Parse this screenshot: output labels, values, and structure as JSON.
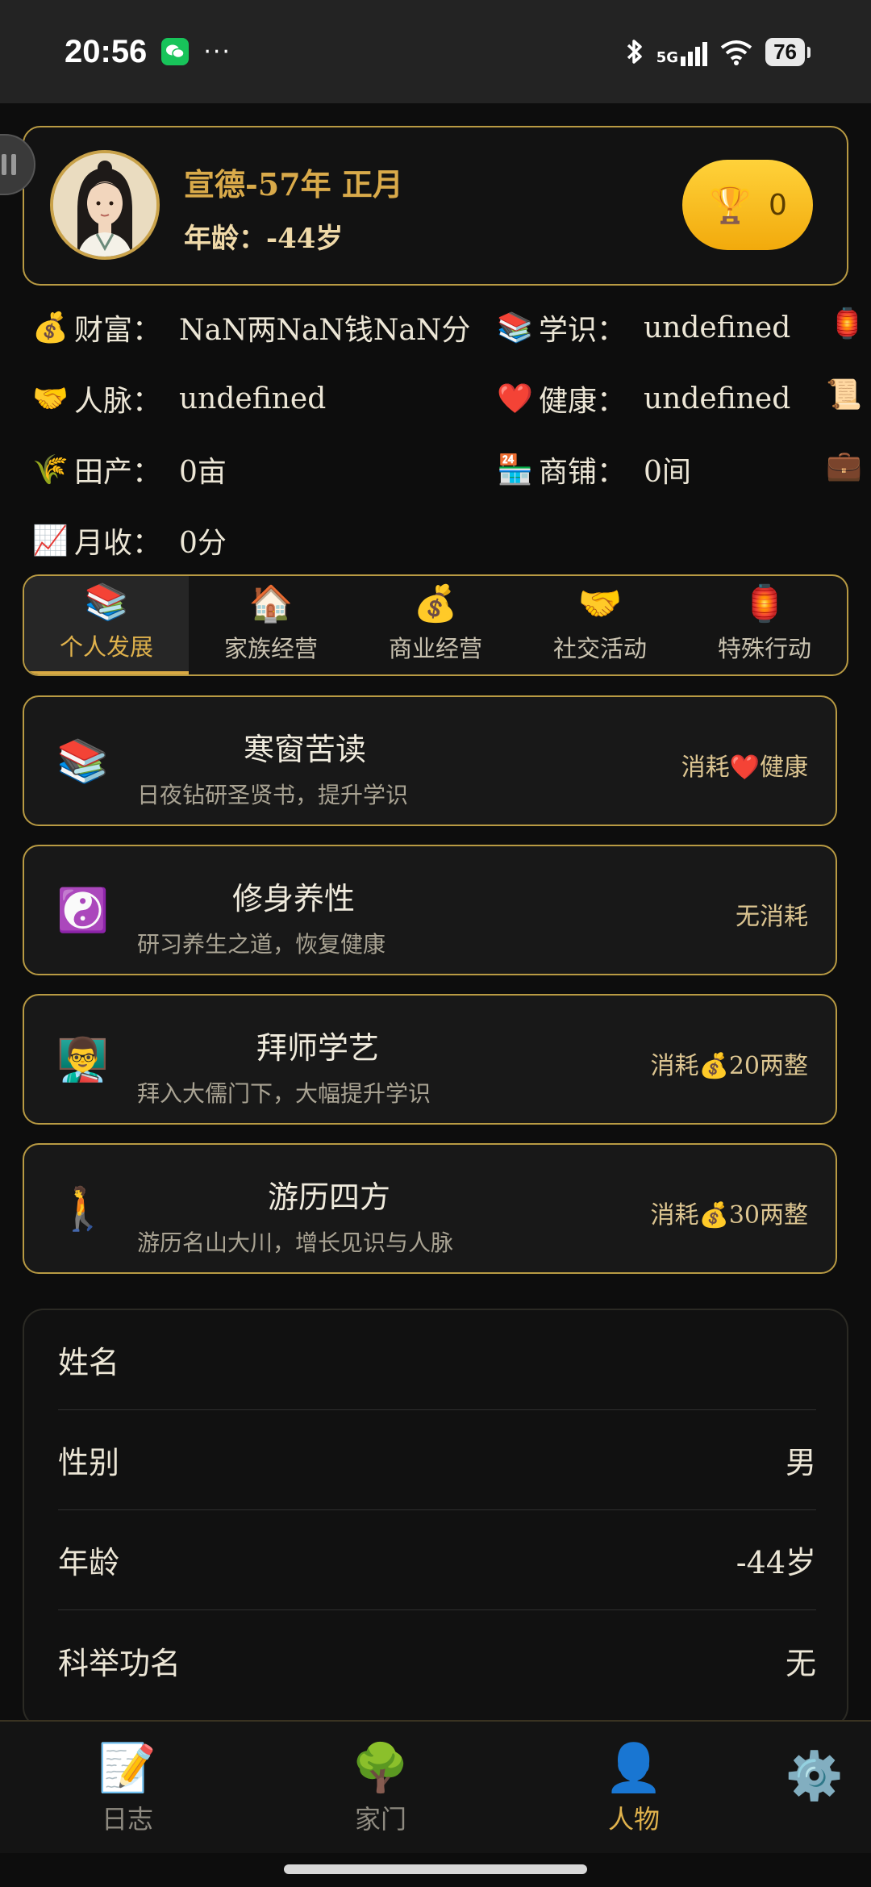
{
  "status_bar": {
    "time": "20:56",
    "more": "···",
    "network": "5G",
    "battery": "76"
  },
  "header": {
    "era": "宣德-57年 正月",
    "age": "年龄：-44岁",
    "trophy_count": "0"
  },
  "stats": [
    {
      "icon": "💰",
      "label": "财富：",
      "value": "NaN两NaN钱NaN分"
    },
    {
      "icon": "📚",
      "label": "学识：",
      "value": "undefined"
    },
    {
      "icon": "🤝",
      "label": "人脉：",
      "value": "undefined"
    },
    {
      "icon": "❤️",
      "label": "健康：",
      "value": "undefined"
    },
    {
      "icon": "🌾",
      "label": "田产：",
      "value": "0亩"
    },
    {
      "icon": "🏪",
      "label": "商铺：",
      "value": "0间"
    },
    {
      "icon": "📈",
      "label": "月收：",
      "value": "0分"
    }
  ],
  "edge_icons": [
    "🏮",
    "📜",
    "💼"
  ],
  "tabs": [
    {
      "icon": "📚",
      "label": "个人发展",
      "active": true
    },
    {
      "icon": "🏠",
      "label": "家族经营",
      "active": false
    },
    {
      "icon": "💰",
      "label": "商业经营",
      "active": false
    },
    {
      "icon": "🤝",
      "label": "社交活动",
      "active": false
    },
    {
      "icon": "🏮",
      "label": "特殊行动",
      "active": false
    }
  ],
  "activities": [
    {
      "icon": "📚",
      "title": "寒窗苦读",
      "desc": "日夜钻研圣贤书，提升学识",
      "cost": "消耗❤️健康"
    },
    {
      "icon": "☯️",
      "title": "修身养性",
      "desc": "研习养生之道，恢复健康",
      "cost": "无消耗"
    },
    {
      "icon": "👨‍🏫",
      "title": "拜师学艺",
      "desc": "拜入大儒门下，大幅提升学识",
      "cost": "消耗💰20两整"
    },
    {
      "icon": "🚶",
      "title": "游历四方",
      "desc": "游历名山大川，增长见识与人脉",
      "cost": "消耗💰30两整"
    }
  ],
  "info": [
    {
      "label": "姓名",
      "value": ""
    },
    {
      "label": "性别",
      "value": "男"
    },
    {
      "label": "年龄",
      "value": "-44岁"
    },
    {
      "label": "科举功名",
      "value": "无"
    }
  ],
  "nav": [
    {
      "icon": "📝",
      "label": "日志",
      "active": false
    },
    {
      "icon": "🌳",
      "label": "家门",
      "active": false
    },
    {
      "icon": "👤",
      "label": "人物",
      "active": true
    },
    {
      "icon": "⚙️",
      "label": "",
      "active": false
    }
  ],
  "colors": {
    "accent_gold": "#d9aa4a",
    "border_gold": "#b89a43",
    "background": "#0d0d0d",
    "trophy_button": "#ffc61e"
  }
}
